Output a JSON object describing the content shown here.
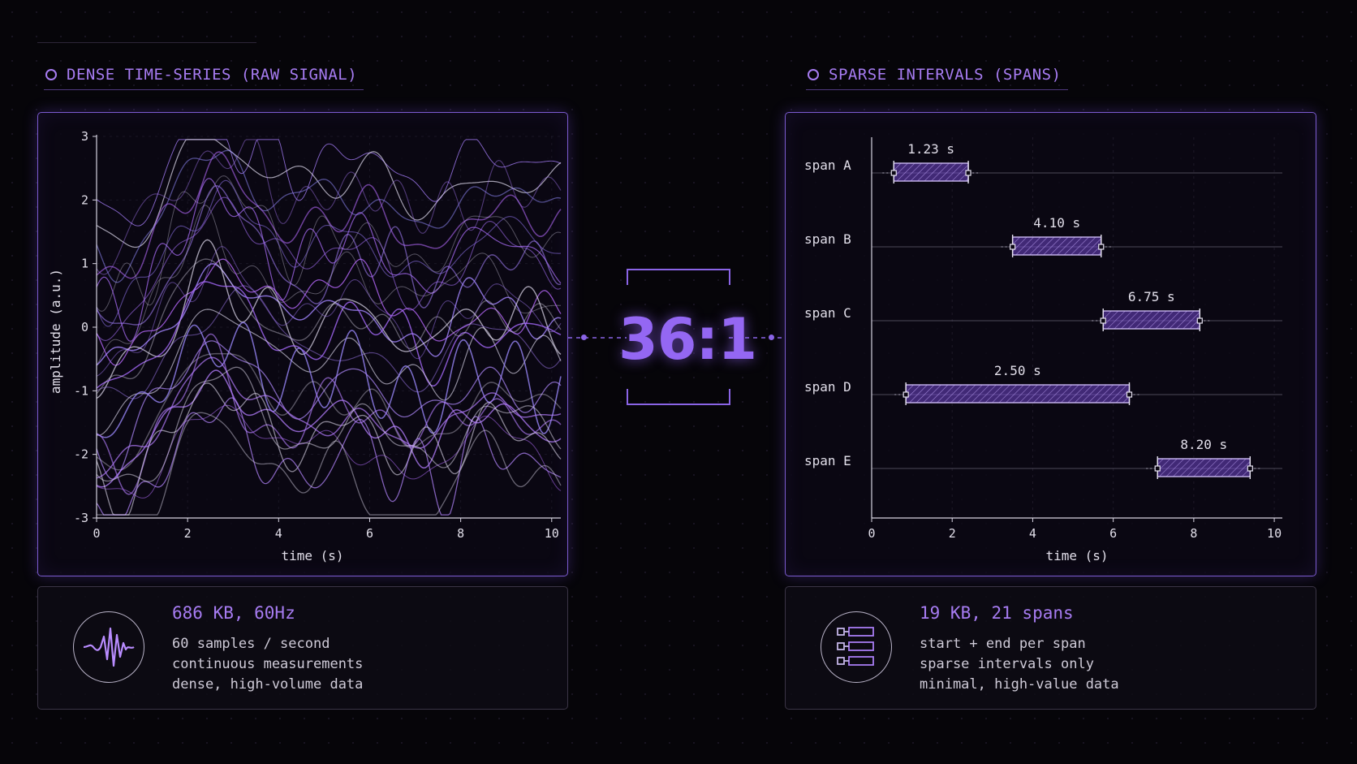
{
  "left": {
    "title": "DENSE TIME-SERIES (RAW SIGNAL)",
    "info": {
      "headline": "686 KB, 60Hz",
      "lines": [
        "60 samples / second",
        "continuous measurements",
        "dense, high-volume data"
      ]
    }
  },
  "right": {
    "title": "SPARSE INTERVALS (SPANS)",
    "info": {
      "headline": "19 KB, 21 spans",
      "lines": [
        "start + end per span",
        "sparse intervals only",
        "minimal, high-value data"
      ]
    }
  },
  "ratio": "36:1",
  "colors": {
    "accent": "#a77cf2",
    "panel_border": "#7b5bd0",
    "background": "#060509"
  },
  "chart_data": [
    {
      "type": "line",
      "xlabel": "time (s)",
      "ylabel": "amplitude (a.u.)",
      "xlim": [
        0,
        10.2
      ],
      "ylim": [
        -3,
        3
      ],
      "xticks": [
        0,
        2,
        4,
        6,
        8,
        10
      ],
      "yticks": [
        -3,
        -2,
        -1,
        0,
        1,
        2,
        3
      ],
      "series_count": 30,
      "series_offsets": [
        2.5,
        2.2,
        1.9,
        1.6,
        1.3,
        1.1,
        0.9,
        0.6,
        0.3,
        0.1,
        0.0,
        -0.2,
        -0.4,
        -0.6,
        -0.9,
        -1.1,
        -1.3,
        -1.5,
        -1.6,
        -1.8,
        -2.0,
        -2.2,
        -2.5,
        1.0,
        1.2,
        0.0,
        0.2,
        -1.5,
        -1.7,
        2.0
      ]
    },
    {
      "type": "gantt",
      "xlabel": "time (s)",
      "xlim": [
        0,
        10.2
      ],
      "xticks": [
        0,
        2,
        4,
        6,
        8,
        10
      ],
      "spans": [
        {
          "name": "span A",
          "start": 0.55,
          "end": 2.4,
          "label": "1.23 s"
        },
        {
          "name": "span B",
          "start": 3.5,
          "end": 5.7,
          "label": "4.10 s"
        },
        {
          "name": "span C",
          "start": 5.75,
          "end": 8.15,
          "label": "6.75 s"
        },
        {
          "name": "span D",
          "start": 0.85,
          "end": 6.4,
          "label": "2.50 s"
        },
        {
          "name": "span E",
          "start": 7.1,
          "end": 9.4,
          "label": "8.20 s"
        }
      ]
    }
  ]
}
